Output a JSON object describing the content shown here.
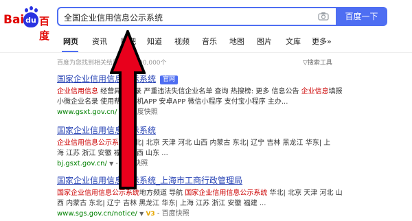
{
  "header": {
    "logo": {
      "part1": "Bai",
      "part2": "du",
      "part3": "百度"
    },
    "search_value": "全国企业信用信息公示系统",
    "search_button": "百度一下"
  },
  "tabs": [
    {
      "label": "网页",
      "active": true
    },
    {
      "label": "资讯"
    },
    {
      "label": "贴吧"
    },
    {
      "label": "知道"
    },
    {
      "label": "视频"
    },
    {
      "label": "音乐"
    },
    {
      "label": "地图"
    },
    {
      "label": "图片"
    },
    {
      "label": "地图"
    },
    {
      "label": "文库"
    },
    {
      "label": "更多»"
    }
  ],
  "result_count": "百度为您找到相关结果约25,900,000个",
  "search_tools": "搜索工具",
  "results": [
    {
      "title": "国家企业信用信息公示系统",
      "badge": "官网",
      "abstract_l1_hl": "企业信用信息",
      "abstract_l1": " 经营异常名录 严重违法失信企业名单 查询 热搜榜: 更多 信息公告 ",
      "abstract_l1_hl2": "企业信息",
      "abstract_l1_end": "填报",
      "abstract_l2": "小微企业名录 使用帮助 手机APP 安卓APP 微信小程序 支付宝小程序 主办...",
      "url": "www.gsxt.gov.cn/",
      "snapshot": "百度快照"
    },
    {
      "title": "国家企业信用信息公示系统",
      "abstract_l1_hl": "企业信用信息公示系统",
      "abstract_l1": " 华北| 北京 天津 河北 山西 内蒙古 东北| 辽宁 吉林 黑龙江 华东| 上",
      "abstract_l2": "海 江苏 浙江 安徽 福建 江西 山东 ...",
      "url": "bj.gsxt.gov.cn/",
      "snapshot": "百度快照"
    },
    {
      "title_hl": "国家企业信用信息公示系统",
      "title_rest": "_上海市工商行政管理局",
      "abstract_l1_hl": "国家企业信用信息公示系统",
      "abstract_l1": "地方频道 导航 ",
      "abstract_l1_hl2": "国家企业信用信息公示系统",
      "abstract_l1_end": " 华北| 北京 天津 河北 山",
      "abstract_l2": "西 内蒙古 东北| 辽宁 吉林 黑龙江 华东| 上海 江苏 浙江 安徽 福建 ...",
      "url": "www.sgs.gov.cn/notice/",
      "v_badge": "V3",
      "snapshot": "百度快照"
    }
  ],
  "colors": {
    "accent": "#4e6ef2",
    "link": "#2440b3",
    "highlight": "#cc0000",
    "url": "#008000",
    "arrow": "#e8001c"
  }
}
